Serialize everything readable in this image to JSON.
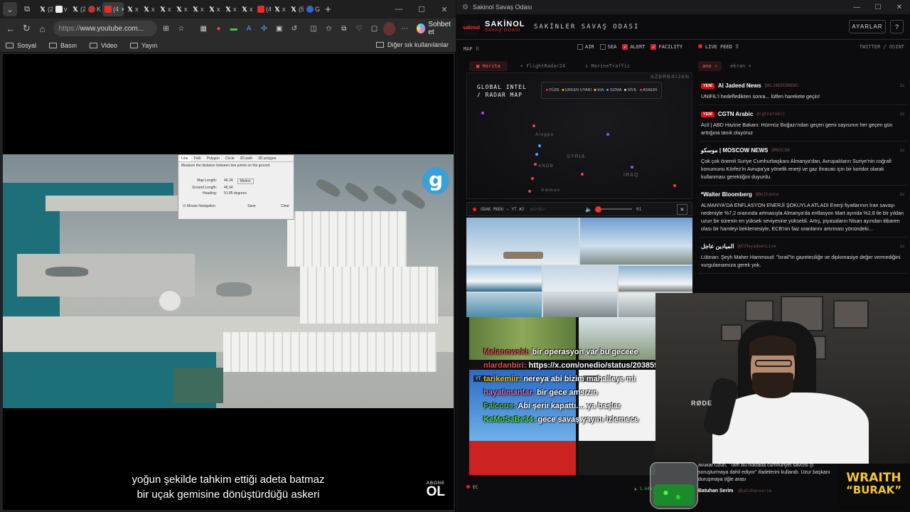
{
  "browser": {
    "tabs": [
      {
        "fav": "x",
        "text": "(2"
      },
      {
        "fav": "white",
        "text": "v"
      },
      {
        "fav": "x",
        "text": "(2"
      },
      {
        "fav": "red",
        "text": "K"
      },
      {
        "fav": "yt",
        "text": "(4",
        "active": true
      },
      {
        "fav": "x",
        "text": "x"
      },
      {
        "fav": "x",
        "text": "x"
      },
      {
        "fav": "x",
        "text": "x"
      },
      {
        "fav": "x",
        "text": "x"
      },
      {
        "fav": "x",
        "text": "x"
      },
      {
        "fav": "x",
        "text": "x"
      },
      {
        "fav": "x",
        "text": "x"
      },
      {
        "fav": "x",
        "text": "x"
      },
      {
        "fav": "yt",
        "text": "(4"
      },
      {
        "fav": "x",
        "text": "x"
      },
      {
        "fav": "x",
        "text": "(5"
      },
      {
        "fav": "blue",
        "text": "G"
      }
    ],
    "url_proto": "https://",
    "url_host": "www.youtube.com...",
    "copilot_label": "Sohbet et",
    "bookmarks": [
      "Sosyal",
      "Basın",
      "Video",
      "Yayın"
    ],
    "bookmarks_other": "Diğer sık kullanılanlar",
    "video": {
      "subtitle_line1": "yoğun şekilde tahkim ettiği adeta batmaz",
      "subtitle_line2": "bir uçak gemisine dönüştürdüğü askeri",
      "channel_abone": "ABONE",
      "channel_logo": "OL",
      "dialog": {
        "tabs": [
          "Line",
          "Path",
          "Polygon",
          "Circle",
          "3D path",
          "3D polygon"
        ],
        "desc": "Measure the distance between two points on the ground",
        "rows": [
          {
            "label": "Map Length:",
            "value": "46.34",
            "unit": "Meters"
          },
          {
            "label": "Ground Length:",
            "value": "46.34",
            "unit": ""
          },
          {
            "label": "Heading:",
            "value": "51.85 degrees",
            "unit": ""
          }
        ],
        "mouse_nav": "Mouse Navigation",
        "save": "Save",
        "clear": "Clear"
      },
      "logo_letter": "g"
    }
  },
  "app": {
    "window_title": "Sakinol Savaş Odası",
    "brand_name": "SAKİNOL",
    "brand_sub": "SAVAŞ ODASI",
    "logo_text": "sakinol",
    "header_title": "SAKİNLER SAVAŞ ODASI",
    "settings_label": "AYARLAR",
    "help_label": "?",
    "map_label": "MAP ⠿",
    "filters": [
      {
        "label": "AIR",
        "on": false
      },
      {
        "label": "SEA",
        "on": false
      },
      {
        "label": "ALERT",
        "on": true
      },
      {
        "label": "FACILITY",
        "on": true
      }
    ],
    "live_feed_label": "LIVE FEED ⠿",
    "live_feed_source": "TWITTER / OSINT",
    "map_tabs": [
      "Harita",
      "FlightRadar24",
      "MarineTraffic"
    ],
    "map_title_1": "GLOBAL INTEL",
    "map_title_2": "/ RADAR MAP",
    "legend": [
      "FÜZE",
      "ERKEN UYARI",
      "İHA",
      "SIZMA",
      "SİVİL",
      "ASKERİ"
    ],
    "map_labels": [
      "SYRIA",
      "IRAQ",
      "AZERBAIJAN",
      "ANON",
      "Amman",
      "Aleppo"
    ],
    "feed_tabs": [
      "ana",
      "ekran"
    ],
    "feed": [
      {
        "badge": "YENİ",
        "name": "Al Jadeed News",
        "handle": "@ALJADEEDNEWS",
        "time": "1s",
        "text": "UNIFIL'i hedefledikten sonra... lütfen harekete geçin!"
      },
      {
        "badge": "YENİ",
        "name": "CGTN Arabic",
        "handle": "@cgtnarabic",
        "time": "1s",
        "text": "Acil | ABD Hazine Bakanı: Hürmüz Boğazı'ndan geçen gemi sayısının her geçen gün arttığına tanık oluyoruz"
      },
      {
        "badge": "",
        "name": "موسكو | MOSCOW NEWS",
        "handle": "@MOSCOW",
        "time": "1s",
        "text": "Çok çok önemli Suriye Cumhurbaşkanı Almanya'dan, Avrupalıların Suriye'nin coğrafi konumunu Körfez'in Avrupa'ya yönelik enerji ve gaz ihracatı için bir koridor olarak kullanması gerektiğini duyurdu."
      },
      {
        "badge": "",
        "name": "*Walter Bloomberg",
        "handle": "@DeItaone",
        "time": "1s",
        "text": "ALMANYA'DA ENFLASYON ENERJİ ŞOKUYLA ATLADI Enerji fiyatlarının İran savaşı nedeniyle %7,2 oranında artmasıyla Almanya'da enflasyon Mart ayında %2,8 ile bir yıldan uzun bir sürenin en yüksek seviyesine yükseldi. Artış, piyasaların Nisan ayından itibaren olası bir hamleyi beklemesiyle, ECB'nin faiz oranlarını artırması yönündeki..."
      },
      {
        "badge": "",
        "name": "الميادين عاجل",
        "handle": "@AlMayadeenLive",
        "time": "1s",
        "text": "Lübnan: Şeyh Maher Hammoud: \"İsrail\"in gazeteciliğe ve diplomasiye değer vermediğini vurgulamamıza gerek yok."
      }
    ],
    "focus_label": "ODAK MODU — YT #2",
    "focus_state": "sürdür",
    "focus_volume": "01",
    "volume_level": 0.0,
    "yt_badges": [
      "YT #3",
      "YT #4"
    ],
    "chat": [
      {
        "name": "Melanowski:",
        "color": "#e05050",
        "text": "bir operasyon var bu geceee"
      },
      {
        "name": "nlardanbiri:",
        "color": "#e05050",
        "text": "https://x.com/onedio/status/2038597297655648404"
      },
      {
        "name": "tarikemiir:",
        "color": "#f0c020",
        "text": "nereya abi bizim mahalleye mi"
      },
      {
        "name": "hayatimantar:",
        "color": "#d070d0",
        "text": "bir gece amsızın"
      },
      {
        "name": "Falcous:",
        "color": "#50c050",
        "text": "Abi şeriı kapattı.... ya başlar"
      },
      {
        "name": "KeMoSaBe34:",
        "color": "#50e050",
        "text": "gece savaş yayını izlemece"
      }
    ],
    "ticker_label": "EC",
    "ticker_value": "▲ 1.64%",
    "bottom_feed_text": "avukat Uzun, \"Tam bu noktada cumhuriyet savcısı çi soruşturmaya dahil ediyor\" ifadelerini kullandı. Uzur başkanı duruşmaya öğle arası",
    "bottom_feed_name": "Batuhan Serim",
    "bottom_feed_handle": "@batuhanserim",
    "cam_brand": "RØDE",
    "sponsor_1": "WRAITH",
    "sponsor_2": "“BURAK”"
  },
  "colors": {
    "accent": "#e33333",
    "app_bg": "#0c0c0e",
    "browser_bg": "#202124"
  }
}
